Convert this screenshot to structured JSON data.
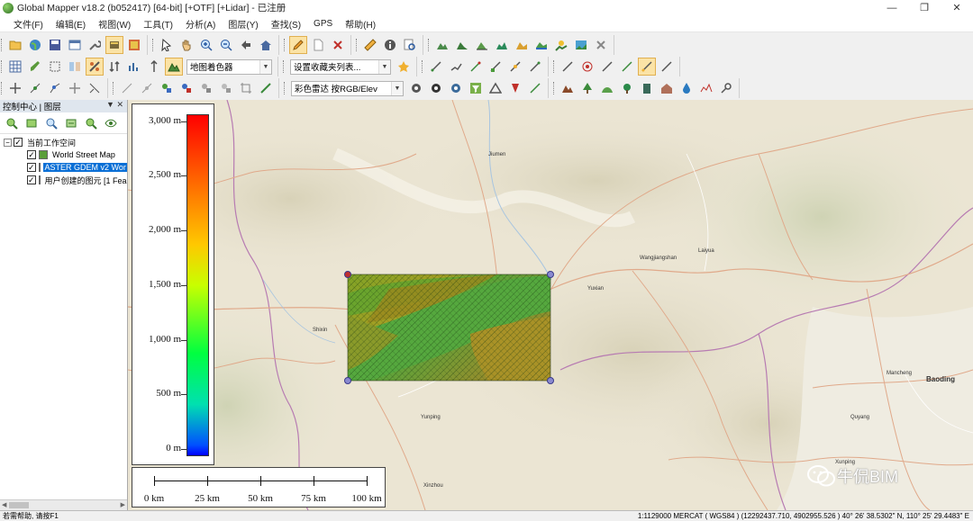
{
  "window": {
    "title": "Global Mapper v18.2 (b052417) [64-bit] [+OTF] [+Lidar] - 已注册",
    "controls": {
      "minimize": "—",
      "maximize": "❐",
      "close": "✕"
    }
  },
  "menu": [
    "文件(F)",
    "编辑(E)",
    "视图(W)",
    "工具(T)",
    "分析(A)",
    "图层(Y)",
    "查找(S)",
    "GPS",
    "帮助(H)"
  ],
  "toolbar": {
    "shader_combo": "地图着色器",
    "favorites_combo": "设置收藏夹列表...",
    "lidar_combo": "彩色雷达 按RGB/Elev"
  },
  "panel": {
    "title": "控制中心 | 图层",
    "controls": "▼ ✕",
    "workspace": "当前工作空间",
    "layers": [
      {
        "label": "World Street Map",
        "checked": "✓",
        "selected": false,
        "color": "#5a9e3a"
      },
      {
        "label": "ASTER GDEM v2 Wor",
        "checked": "✓",
        "selected": true,
        "color": "#8a7a3a"
      },
      {
        "label": "用户创建的图元 [1 Fea",
        "checked": "✓",
        "selected": false,
        "color": "#c8b030"
      }
    ]
  },
  "legend": {
    "labels": [
      "3,000 m",
      "2,500 m",
      "2,000 m",
      "1,500 m",
      "1,000 m",
      "500 m",
      "0 m"
    ],
    "values": [
      3000,
      2500,
      2000,
      1500,
      1000,
      500,
      0
    ]
  },
  "scalebar": {
    "labels": [
      "0 km",
      "25 km",
      "50 km",
      "75 km",
      "100 km"
    ]
  },
  "places": [
    {
      "label": "Jiumen"
    },
    {
      "label": "Wangjiangshan"
    },
    {
      "label": "Laiyua"
    },
    {
      "label": "Yuxian"
    },
    {
      "label": "Shixin"
    },
    {
      "label": "Yunping"
    },
    {
      "label": "Baoding",
      "big": true
    },
    {
      "label": "Mancheng"
    },
    {
      "label": "Quyang"
    },
    {
      "label": "Xinzhou"
    },
    {
      "label": "Xunping"
    }
  ],
  "watermark": "牛侃BIM",
  "status": {
    "left": "若需帮助, 请按F1",
    "right": "1:1129000  MERCAT ( WGS84 ) (12292437.710, 4902955.526 )  40° 26' 38.5302\" N, 110° 25' 29.4483\" E"
  }
}
